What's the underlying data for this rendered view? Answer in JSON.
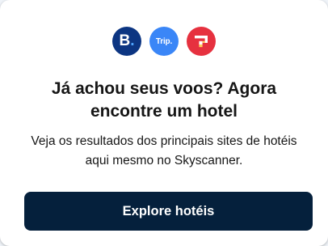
{
  "colors": {
    "booking_bg": "#0c3582",
    "trip_bg": "#3a86f7",
    "third_bg": "#e6313f",
    "button_bg": "#05203c",
    "text": "#161616"
  },
  "logos": [
    {
      "name": "booking-logo-icon",
      "text": "B",
      "dot": "."
    },
    {
      "name": "trip-logo-icon",
      "text": "Trip",
      "dot": "."
    },
    {
      "name": "hotel-site-logo-icon"
    }
  ],
  "card": {
    "headline": "Já achou seus voos? Agora encontre um hotel",
    "description": "Veja os resultados dos principais sites de hotéis aqui mesmo no Skyscanner.",
    "cta_label": "Explore hotéis"
  }
}
